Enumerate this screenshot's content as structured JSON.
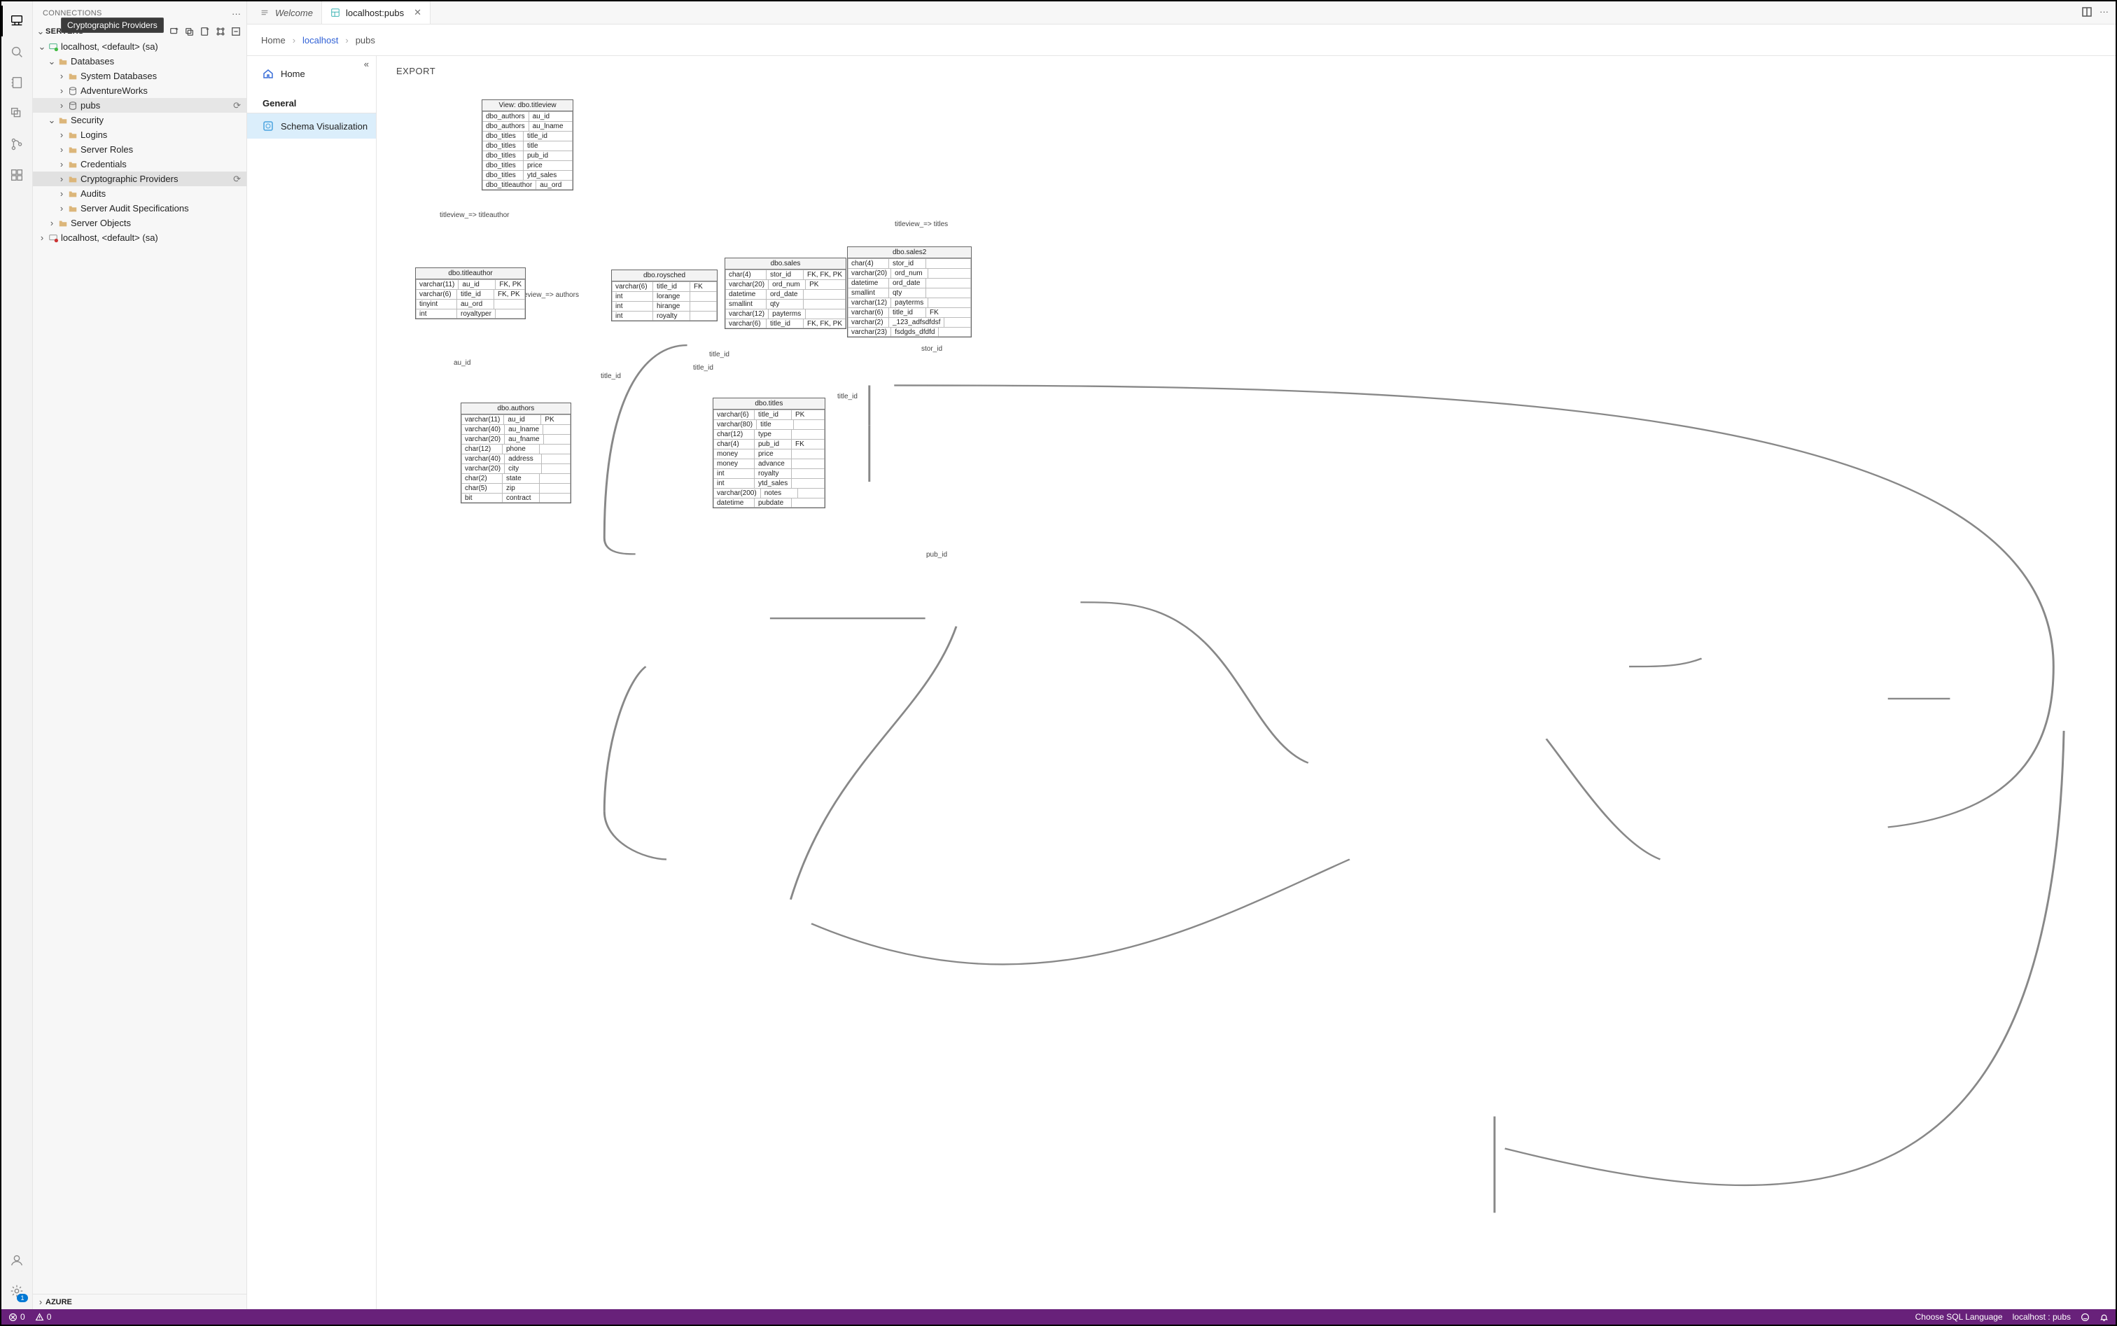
{
  "tooltip": "Cryptographic Providers",
  "panel": {
    "title": "CONNECTIONS",
    "servers_label": "SERVERS",
    "azure_label": "AZURE"
  },
  "tree": {
    "server1": "localhost, <default> (sa)",
    "databases": "Databases",
    "sysdb": "System Databases",
    "adv": "AdventureWorks",
    "pubs": "pubs",
    "security": "Security",
    "logins": "Logins",
    "serverroles": "Server Roles",
    "credentials": "Credentials",
    "crypto": "Cryptographic Providers",
    "audits": "Audits",
    "sas": "Server Audit Specifications",
    "serverobjects": "Server Objects",
    "server2": "localhost, <default> (sa)"
  },
  "tabs": {
    "welcome": "Welcome",
    "main": "localhost:pubs"
  },
  "crumbs": {
    "home": "Home",
    "localhost": "localhost",
    "pubs": "pubs"
  },
  "nav": {
    "home": "Home",
    "general": "General",
    "schema": "Schema Visualization"
  },
  "export_label": "EXPORT",
  "rel_labels": {
    "tv_ta": "titleview_=> titleauthor",
    "tv_au": "titleview_=> authors",
    "tv_ti": "titleview_=> titles",
    "au_id": "au_id",
    "title_id_l": "title_id",
    "title_id_m": "title_id",
    "title_id_r": "title_id",
    "title_id_r2": "title_id",
    "stor_id": "stor_id",
    "pub_id": "pub_id"
  },
  "tables": {
    "titleview": {
      "title": "View: dbo.titleview",
      "rows": [
        [
          "dbo_authors",
          "au_id"
        ],
        [
          "dbo_authors",
          "au_lname"
        ],
        [
          "dbo_titles",
          "title_id"
        ],
        [
          "dbo_titles",
          "title"
        ],
        [
          "dbo_titles",
          "pub_id"
        ],
        [
          "dbo_titles",
          "price"
        ],
        [
          "dbo_titles",
          "ytd_sales"
        ],
        [
          "dbo_titleauthor",
          "au_ord"
        ]
      ]
    },
    "titleauthor": {
      "title": "dbo.titleauthor",
      "rows": [
        [
          "varchar(11)",
          "au_id",
          "FK, PK"
        ],
        [
          "varchar(6)",
          "title_id",
          "FK, PK"
        ],
        [
          "tinyint",
          "au_ord",
          ""
        ],
        [
          "int",
          "royaltyper",
          ""
        ]
      ]
    },
    "authors": {
      "title": "dbo.authors",
      "rows": [
        [
          "varchar(11)",
          "au_id",
          "PK"
        ],
        [
          "varchar(40)",
          "au_lname",
          ""
        ],
        [
          "varchar(20)",
          "au_fname",
          ""
        ],
        [
          "char(12)",
          "phone",
          ""
        ],
        [
          "varchar(40)",
          "address",
          ""
        ],
        [
          "varchar(20)",
          "city",
          ""
        ],
        [
          "char(2)",
          "state",
          ""
        ],
        [
          "char(5)",
          "zip",
          ""
        ],
        [
          "bit",
          "contract",
          ""
        ]
      ]
    },
    "roysched": {
      "title": "dbo.roysched",
      "rows": [
        [
          "varchar(6)",
          "title_id",
          "FK"
        ],
        [
          "int",
          "lorange",
          ""
        ],
        [
          "int",
          "hirange",
          ""
        ],
        [
          "int",
          "royalty",
          ""
        ]
      ]
    },
    "sales": {
      "title": "dbo.sales",
      "rows": [
        [
          "char(4)",
          "stor_id",
          "FK, FK, PK"
        ],
        [
          "varchar(20)",
          "ord_num",
          "PK"
        ],
        [
          "datetime",
          "ord_date",
          ""
        ],
        [
          "smallint",
          "qty",
          ""
        ],
        [
          "varchar(12)",
          "payterms",
          ""
        ],
        [
          "varchar(6)",
          "title_id",
          "FK, FK, PK"
        ]
      ]
    },
    "sales2": {
      "title": "dbo.sales2",
      "rows": [
        [
          "char(4)",
          "stor_id",
          ""
        ],
        [
          "varchar(20)",
          "ord_num",
          ""
        ],
        [
          "datetime",
          "ord_date",
          ""
        ],
        [
          "smallint",
          "qty",
          ""
        ],
        [
          "varchar(12)",
          "payterms",
          ""
        ],
        [
          "varchar(6)",
          "title_id",
          "FK"
        ],
        [
          "varchar(2)",
          "_123_adfsdfdsf",
          ""
        ],
        [
          "varchar(23)",
          "fsdgds_dfdfd",
          ""
        ]
      ]
    },
    "titles": {
      "title": "dbo.titles",
      "rows": [
        [
          "varchar(6)",
          "title_id",
          "PK"
        ],
        [
          "varchar(80)",
          "title",
          ""
        ],
        [
          "char(12)",
          "type",
          ""
        ],
        [
          "char(4)",
          "pub_id",
          "FK"
        ],
        [
          "money",
          "price",
          ""
        ],
        [
          "money",
          "advance",
          ""
        ],
        [
          "int",
          "royalty",
          ""
        ],
        [
          "int",
          "ytd_sales",
          ""
        ],
        [
          "varchar(200)",
          "notes",
          ""
        ],
        [
          "datetime",
          "pubdate",
          ""
        ]
      ]
    }
  },
  "status": {
    "errors": "0",
    "warnings": "0",
    "lang": "Choose SQL Language",
    "conn": "localhost : pubs"
  },
  "settings_badge": "1"
}
